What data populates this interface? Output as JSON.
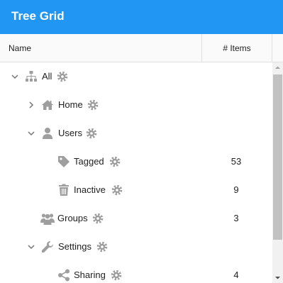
{
  "title": "Tree Grid",
  "columns": {
    "name": "Name",
    "items": "# Items"
  },
  "rows": [
    {
      "label": "All",
      "icon": "sitemap-icon",
      "expanded": true,
      "count": ""
    },
    {
      "label": "Home",
      "icon": "home-icon",
      "expanded": false,
      "count": ""
    },
    {
      "label": "Users",
      "icon": "user-icon",
      "expanded": true,
      "count": ""
    },
    {
      "label": "Tagged",
      "icon": "tag-icon",
      "count": "53"
    },
    {
      "label": "Inactive",
      "icon": "trash-icon",
      "count": "9"
    },
    {
      "label": "Groups",
      "icon": "users-icon",
      "count": "3"
    },
    {
      "label": "Settings",
      "icon": "wrench-icon",
      "expanded": true,
      "count": ""
    },
    {
      "label": "Sharing",
      "icon": "share-icon",
      "count": "4"
    }
  ],
  "colors": {
    "accent": "#2196f3",
    "icon": "#9e9e9e",
    "text": "#212121"
  }
}
